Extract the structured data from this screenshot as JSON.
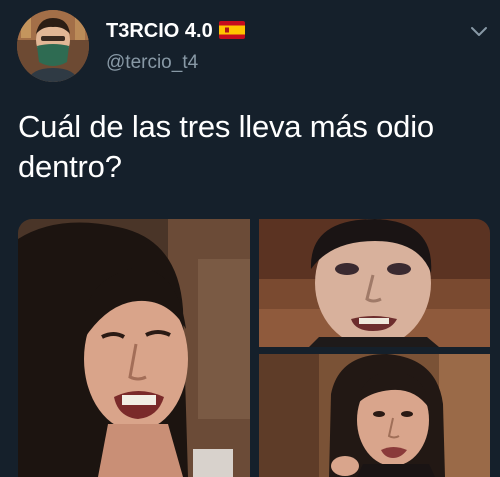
{
  "tweet": {
    "display_name": "T3RCIO 4.0",
    "handle": "@tercio_t4",
    "text": "Cuál de las tres lleva más odio dentro?"
  },
  "icons": {
    "flag": "spain-flag-icon",
    "menu": "chevron-down-icon"
  },
  "colors": {
    "background": "#15202b",
    "name": "#ffffff",
    "handle": "#8899a6",
    "text": "#ffffff"
  },
  "media": {
    "count": 3
  }
}
